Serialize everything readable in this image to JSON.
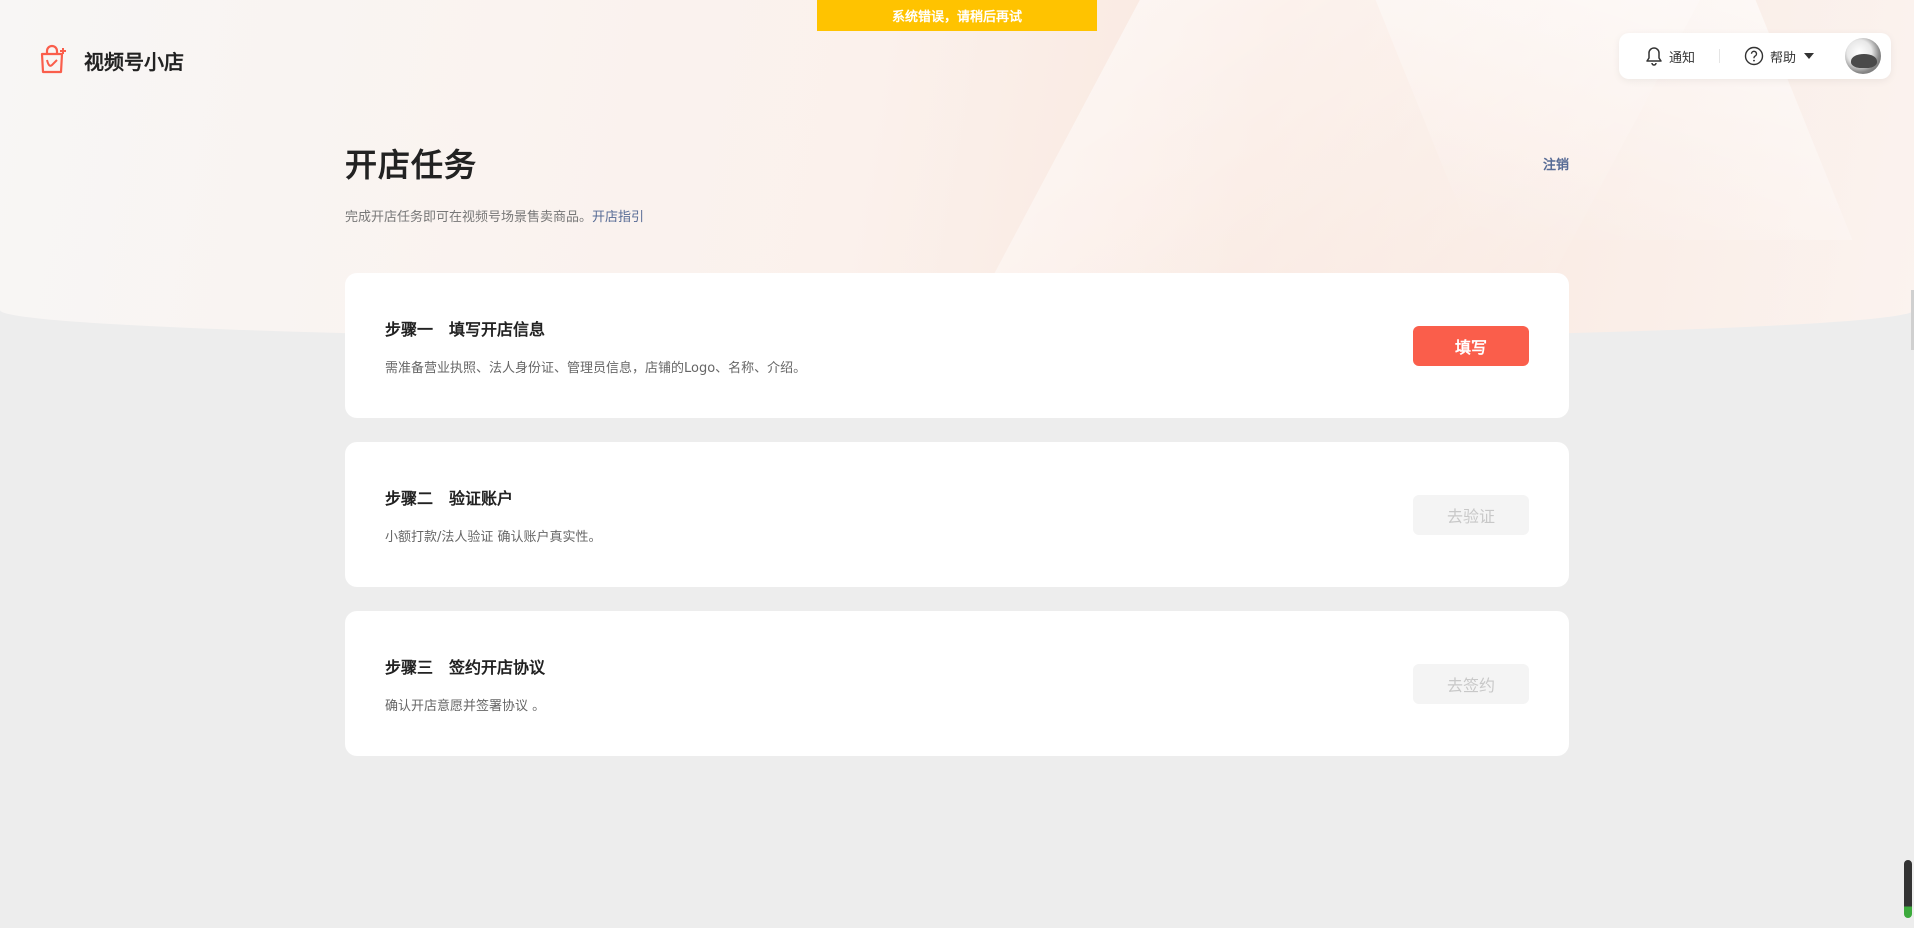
{
  "banner": {
    "text": "系统错误，请稍后再试"
  },
  "brand": {
    "name": "视频号小店",
    "logo_icon": "shop-bag-icon",
    "accent": "#fa5e4b"
  },
  "top_actions": {
    "notify_label": "通知",
    "notify_icon": "bell-icon",
    "help_label": "帮助",
    "help_icon": "question-circle-icon"
  },
  "page": {
    "title": "开店任务",
    "subtitle": "完成开店任务即可在视频号场景售卖商品。",
    "guide_link": "开店指引",
    "logout_label": "注销",
    "link_color": "#576b95"
  },
  "steps": [
    {
      "title": "步骤一　填写开店信息",
      "desc": "需准备营业执照、法人身份证、管理员信息，店铺的Logo、名称、介绍。",
      "button": "填写",
      "enabled": true
    },
    {
      "title": "步骤二　验证账户",
      "desc": "小额打款/法人验证 确认账户真实性。",
      "button": "去验证",
      "enabled": false
    },
    {
      "title": "步骤三　签约开店协议",
      "desc": "确认开店意愿并签署协议 。",
      "button": "去签约",
      "enabled": false
    }
  ]
}
